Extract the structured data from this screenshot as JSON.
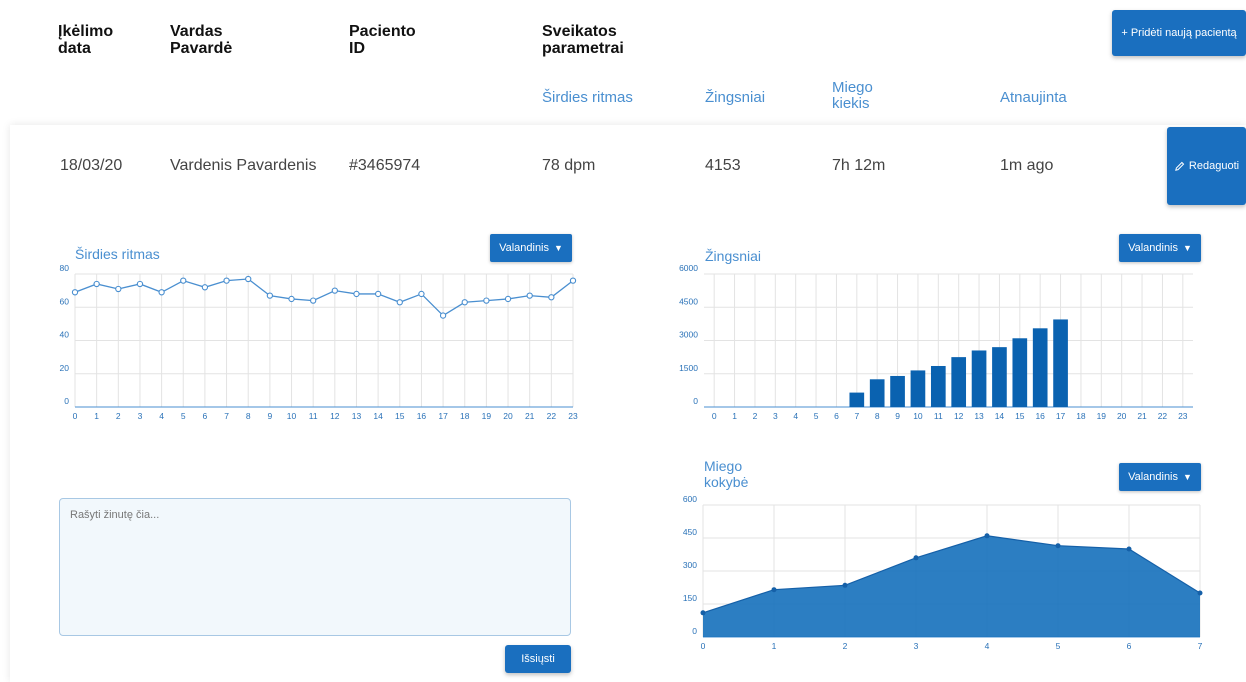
{
  "header": {
    "col_upload_date": "Įkėlimo\ndata",
    "col_name": "Vardas\nPavardė",
    "col_patient_id": "Paciento\nID",
    "col_health": "Sveikatos\nparametrai",
    "sub_heart": "Širdies ritmas",
    "sub_steps": "Žingsniai",
    "sub_sleep": "Miego\nkiekis",
    "sub_updated": "Atnaujinta",
    "add_patient_label": "+ Pridėti naują pacientą"
  },
  "patient": {
    "date": "18/03/20",
    "name": "Vardenis Pavardenis",
    "id": "#3465974",
    "heart_rate": "78 dpm",
    "steps": "4153",
    "sleep": "7h 12m",
    "updated": "1m ago",
    "edit_label": "Redaguoti"
  },
  "dropdown_label": "Valandinis",
  "message": {
    "placeholder": "Rašyti žinutę čia...",
    "send_label": "Išsiųsti"
  },
  "colors": {
    "accent": "#1a6fbf",
    "line": "#4a8fd0",
    "bar": "#0a62b0",
    "area": "#1a73bd",
    "grid": "#e3e3e3"
  },
  "chart_data": [
    {
      "type": "line",
      "title": "Širdies ritmas",
      "x": [
        0,
        1,
        2,
        3,
        4,
        5,
        6,
        7,
        8,
        9,
        10,
        11,
        12,
        13,
        14,
        15,
        16,
        17,
        18,
        19,
        20,
        21,
        22,
        23
      ],
      "values": [
        69,
        74,
        71,
        74,
        69,
        76,
        72,
        76,
        77,
        67,
        65,
        64,
        70,
        68,
        68,
        63,
        68,
        55,
        63,
        64,
        65,
        67,
        66,
        76
      ],
      "ylim": [
        0,
        80
      ],
      "yticks": [
        0,
        20,
        40,
        60,
        80
      ],
      "grid": true
    },
    {
      "type": "bar",
      "title": "Žingsniai",
      "categories": [
        0,
        1,
        2,
        3,
        4,
        5,
        6,
        7,
        8,
        9,
        10,
        11,
        12,
        13,
        14,
        15,
        16,
        17,
        18,
        19,
        20,
        21,
        22,
        23
      ],
      "values": [
        0,
        0,
        0,
        0,
        0,
        0,
        0,
        650,
        1250,
        1400,
        1650,
        1850,
        2250,
        2550,
        2700,
        3100,
        3550,
        3950,
        0,
        0,
        0,
        0,
        0,
        0
      ],
      "ylim": [
        0,
        6000
      ],
      "yticks": [
        0,
        1500,
        3000,
        4500,
        6000
      ],
      "grid": true
    },
    {
      "type": "area",
      "title": "Miego\nkokybė",
      "x": [
        0,
        1,
        2,
        3,
        4,
        5,
        6,
        7
      ],
      "values": [
        110,
        215,
        235,
        360,
        460,
        415,
        400,
        200
      ],
      "ylim": [
        0,
        600
      ],
      "yticks": [
        0,
        150,
        300,
        450,
        600
      ],
      "grid": true
    }
  ]
}
